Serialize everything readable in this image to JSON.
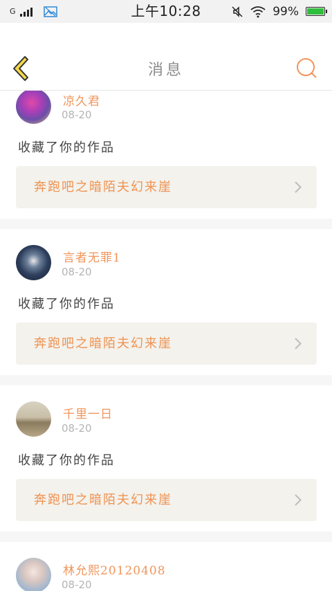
{
  "status_bar": {
    "network": "G",
    "time": "上午10:28",
    "battery_pct": "99%",
    "battery_level": 0.99,
    "battery_color": "#2fbf3d"
  },
  "header": {
    "title": "消息"
  },
  "colors": {
    "accent": "#f0955b",
    "back_icon_fill": "#f5d94a",
    "search_icon": "#f0955b"
  },
  "messages": [
    {
      "username": "凉久君",
      "date": "08-20",
      "action": "收藏了你的作品",
      "work_title": "奔跑吧之暗陌夫幻来崖"
    },
    {
      "username": "言者无罪1",
      "date": "08-20",
      "action": "收藏了你的作品",
      "work_title": "奔跑吧之暗陌夫幻来崖"
    },
    {
      "username": "千里一日",
      "date": "08-20",
      "action": "收藏了你的作品",
      "work_title": "奔跑吧之暗陌夫幻来崖"
    },
    {
      "username": "林允熙20120408",
      "date": "08-20",
      "action": "",
      "work_title": ""
    }
  ]
}
